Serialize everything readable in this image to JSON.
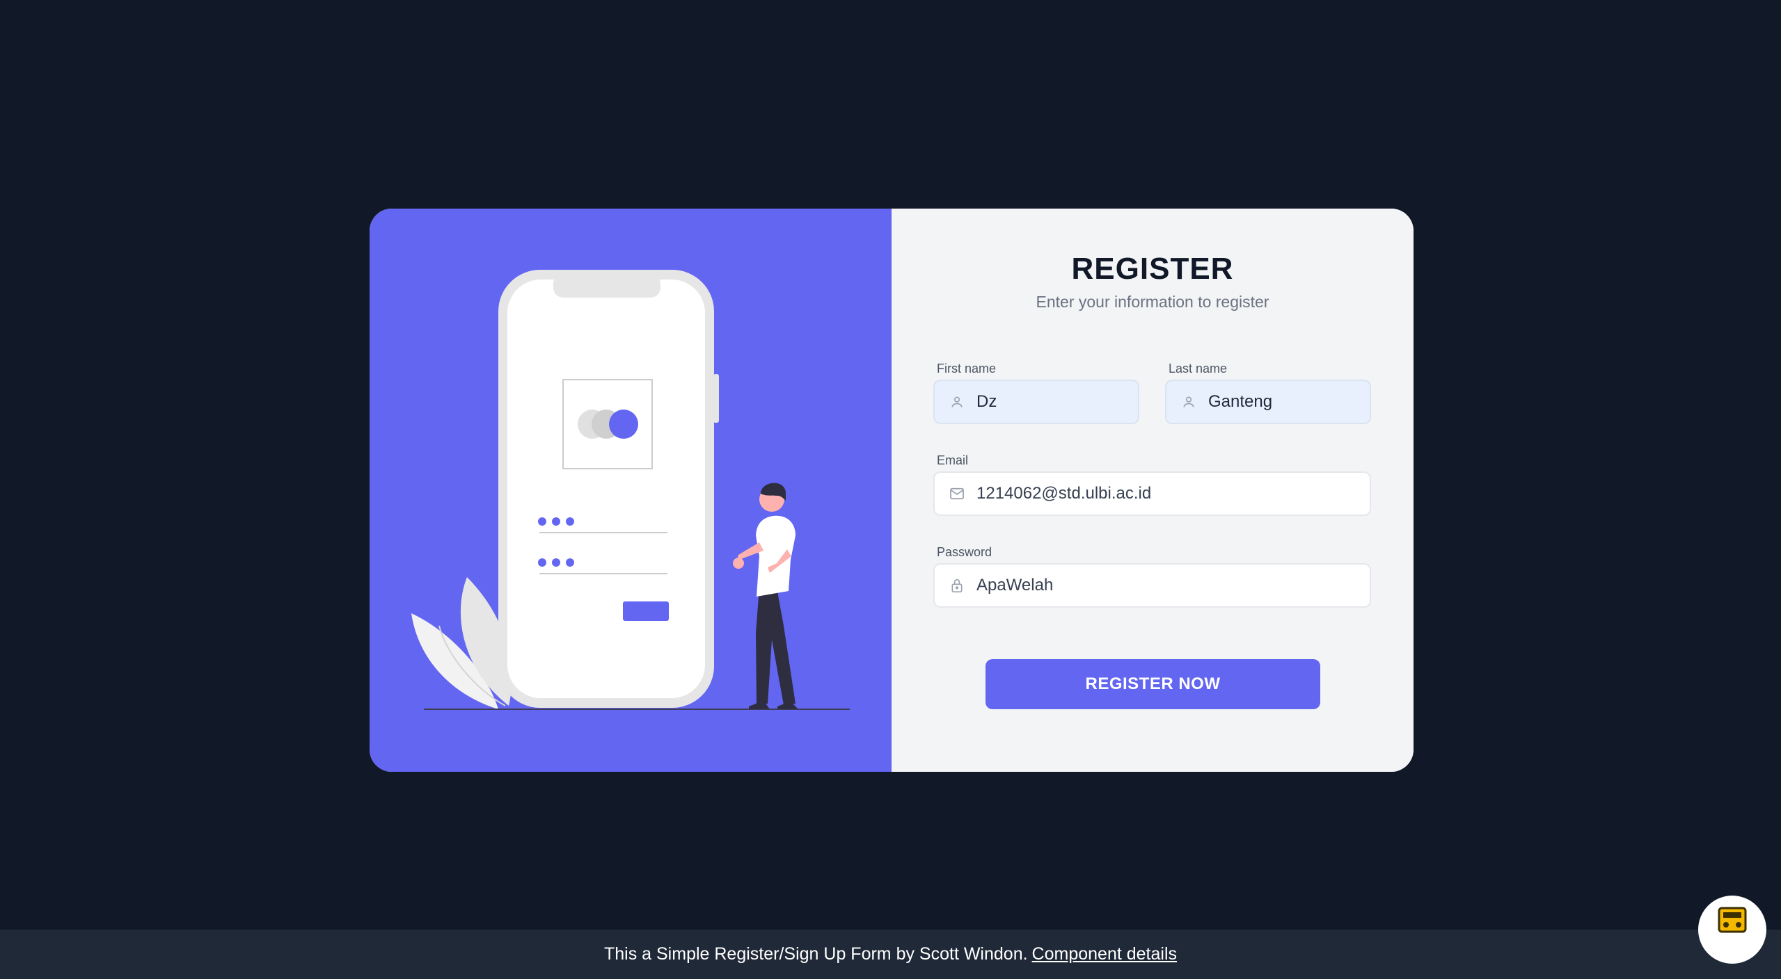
{
  "form": {
    "title": "REGISTER",
    "subtitle": "Enter your information to register",
    "first_name": {
      "label": "First name",
      "value": "Dz",
      "icon": "user-icon"
    },
    "last_name": {
      "label": "Last name",
      "value": "Ganteng",
      "icon": "user-icon"
    },
    "email": {
      "label": "Email",
      "value": "1214062@std.ulbi.ac.id",
      "icon": "mail-icon"
    },
    "password": {
      "label": "Password",
      "value": "ApaWelah",
      "icon": "lock-icon"
    },
    "submit_label": "REGISTER NOW"
  },
  "footer": {
    "text": "This a Simple Register/Sign Up Form by Scott Windon.",
    "link_label": "Component details"
  },
  "colors": {
    "background": "#111827",
    "accent": "#6366f1",
    "panel": "#f3f4f6",
    "footer": "#1f2937"
  }
}
